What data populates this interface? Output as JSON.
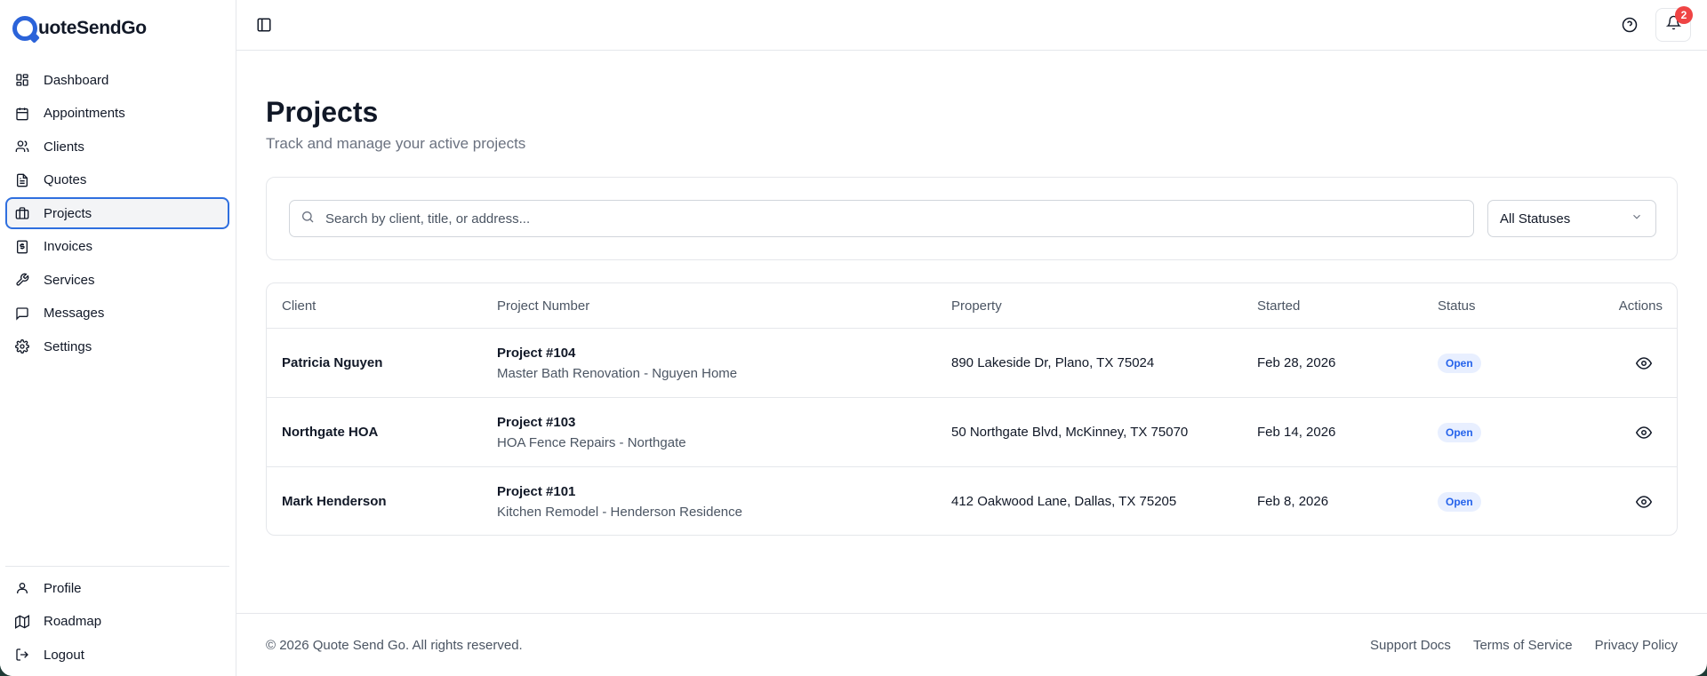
{
  "brand": {
    "name": "uoteSendGo",
    "accent": "#2b63d9"
  },
  "sidebar": {
    "items": [
      {
        "label": "Dashboard",
        "icon": "dashboard-icon"
      },
      {
        "label": "Appointments",
        "icon": "calendar-icon"
      },
      {
        "label": "Clients",
        "icon": "users-icon"
      },
      {
        "label": "Quotes",
        "icon": "file-text-icon"
      },
      {
        "label": "Projects",
        "icon": "briefcase-icon",
        "active": true
      },
      {
        "label": "Invoices",
        "icon": "receipt-icon"
      },
      {
        "label": "Services",
        "icon": "wrench-icon"
      },
      {
        "label": "Messages",
        "icon": "message-icon"
      },
      {
        "label": "Settings",
        "icon": "gear-icon"
      }
    ],
    "bottom_items": [
      {
        "label": "Profile",
        "icon": "user-icon"
      },
      {
        "label": "Roadmap",
        "icon": "map-icon"
      },
      {
        "label": "Logout",
        "icon": "logout-icon"
      }
    ]
  },
  "topbar": {
    "notification_count": "2"
  },
  "page": {
    "title": "Projects",
    "subtitle": "Track and manage your active projects"
  },
  "filters": {
    "search_placeholder": "Search by client, title, or address...",
    "status_value": "All Statuses"
  },
  "table": {
    "headers": [
      "Client",
      "Project Number",
      "Property",
      "Started",
      "Status",
      "Actions"
    ],
    "rows": [
      {
        "client": "Patricia Nguyen",
        "project_number": "Project #104",
        "project_title": "Master Bath Renovation - Nguyen Home",
        "property": "890 Lakeside Dr, Plano, TX 75024",
        "started": "Feb 28, 2026",
        "status": "Open"
      },
      {
        "client": "Northgate HOA",
        "project_number": "Project #103",
        "project_title": "HOA Fence Repairs - Northgate",
        "property": "50 Northgate Blvd, McKinney, TX 75070",
        "started": "Feb 14, 2026",
        "status": "Open"
      },
      {
        "client": "Mark Henderson",
        "project_number": "Project #101",
        "project_title": "Kitchen Remodel - Henderson Residence",
        "property": "412 Oakwood Lane, Dallas, TX 75205",
        "started": "Feb 8, 2026",
        "status": "Open"
      }
    ]
  },
  "footer": {
    "copyright": "© 2026 Quote Send Go. All rights reserved.",
    "links": [
      "Support Docs",
      "Terms of Service",
      "Privacy Policy"
    ]
  }
}
